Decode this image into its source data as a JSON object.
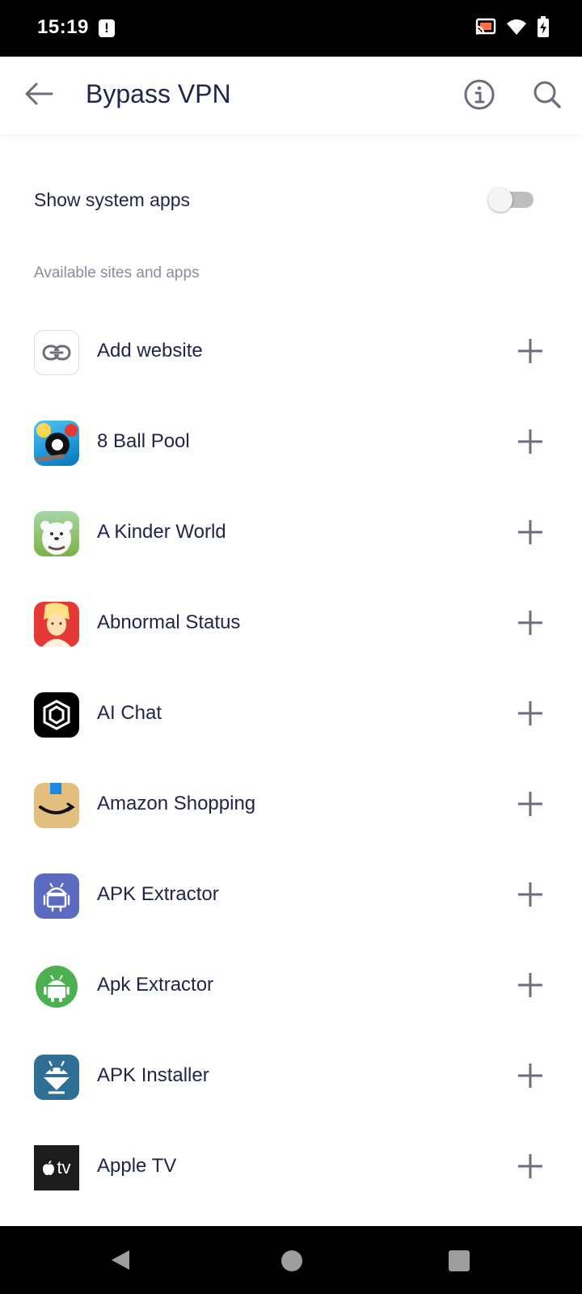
{
  "status_bar": {
    "time": "15:19",
    "icons": [
      "alert-icon",
      "cast-icon",
      "wifi-icon",
      "battery-charging-icon"
    ]
  },
  "app_bar": {
    "title": "Bypass VPN",
    "back_icon": "arrow-left-icon",
    "info_icon": "info-icon",
    "search_icon": "search-icon"
  },
  "settings": {
    "show_system_apps_label": "Show system apps",
    "show_system_apps_enabled": false
  },
  "section": {
    "label": "Available sites and apps"
  },
  "apps": [
    {
      "name": "Add website",
      "icon": "link-icon"
    },
    {
      "name": "8 Ball Pool",
      "icon": "8-ball-pool-icon"
    },
    {
      "name": "A Kinder World",
      "icon": "a-kinder-world-icon"
    },
    {
      "name": "Abnormal Status",
      "icon": "abnormal-status-icon"
    },
    {
      "name": "AI Chat",
      "icon": "ai-chat-icon"
    },
    {
      "name": "Amazon Shopping",
      "icon": "amazon-shopping-icon"
    },
    {
      "name": "APK Extractor",
      "icon": "android-robot-icon"
    },
    {
      "name": "Apk Extractor",
      "icon": "android-robot-icon"
    },
    {
      "name": "APK Installer",
      "icon": "apk-installer-icon"
    },
    {
      "name": "Apple TV",
      "icon": "apple-tv-icon",
      "icon_text": "tv"
    }
  ],
  "colors": {
    "text_primary": "#22254a",
    "text_secondary": "#8a8c9c",
    "add_icon": "#6b6d7a"
  },
  "nav_bar": {
    "icons": [
      "nav-back-icon",
      "nav-home-icon",
      "nav-recents-icon"
    ]
  }
}
